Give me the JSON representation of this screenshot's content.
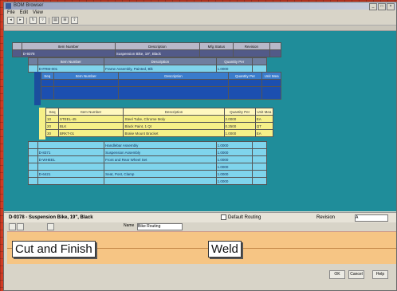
{
  "window": {
    "title": "BOM Browser"
  },
  "menu": [
    "File",
    "Edit",
    "View"
  ],
  "top_table": {
    "headers": [
      "",
      "Item Number",
      "Description",
      "Mfg Status",
      "Revision",
      ""
    ],
    "row": [
      "",
      "D-9378",
      "Suspension Bike, 19\", Black",
      "",
      "",
      ""
    ]
  },
  "level2": {
    "headers": [
      "",
      "Item Number",
      "Description",
      "Quantity Per",
      ""
    ],
    "rows": [
      [
        "",
        "D-FRM-001",
        "Frame Assembly, Painted, Blk",
        "1.0000",
        ""
      ]
    ]
  },
  "level3": {
    "headers": [
      "Seq",
      "Item Number",
      "Description",
      "Quantity Per",
      "Unit Mea"
    ],
    "rows": [
      [
        "",
        "",
        "",
        "",
        ""
      ],
      [
        "",
        "",
        "",
        "",
        ""
      ]
    ]
  },
  "level4": {
    "headers": [
      "Seq",
      "Item Number",
      "Description",
      "Quantity Per",
      "Unit Mea"
    ],
    "rows": [
      [
        "10",
        "STEEL-45",
        "Steel Tube, Chrome Moly",
        "2.0000",
        "EA"
      ],
      [
        "20",
        "BLK",
        "Black Paint, 1 Qt",
        "0.2500",
        "QT"
      ],
      [
        "30",
        "BRKT-01",
        "Brake Mount Bracket",
        "1.0000",
        "EA"
      ]
    ]
  },
  "level2b": {
    "rows": [
      [
        "",
        "",
        "Handlebar Assembly",
        "1.0000",
        ""
      ],
      [
        "",
        "D-8371",
        "Suspension Assembly",
        "1.0000",
        ""
      ],
      [
        "",
        "D-WHEEL",
        "Front and Rear Wheel Set",
        "1.0000",
        ""
      ],
      [
        "",
        "",
        "",
        "1.0000",
        ""
      ],
      [
        "",
        "D-6421",
        "Seat, Post, Clamp",
        "1.0000",
        ""
      ],
      [
        "",
        "",
        "",
        "1.0000",
        ""
      ]
    ]
  },
  "status": {
    "item": "D-9378 - Suspension Bike, 19\", Black",
    "checkbox": "Default Routing",
    "revision_label": "Revision",
    "revision_value": "A"
  },
  "routing": {
    "name_label": "Name",
    "name_value": "Bike Routing"
  },
  "steps": [
    "Cut and Finish",
    "Weld"
  ],
  "buttons": [
    "OK",
    "Cancel",
    "Help"
  ]
}
